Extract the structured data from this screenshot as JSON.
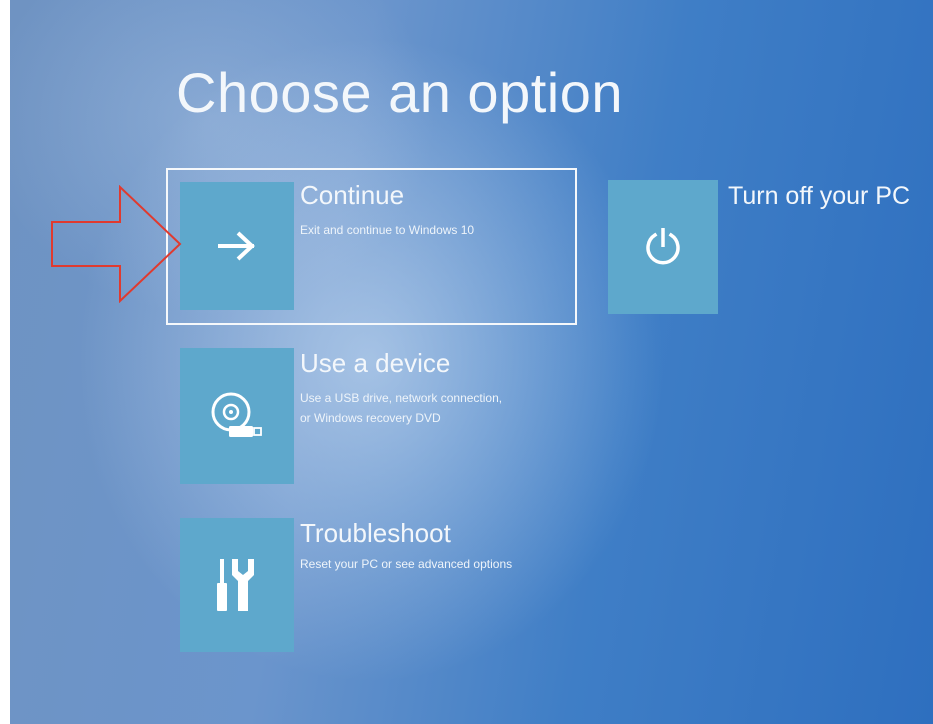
{
  "page": {
    "title": "Choose an option"
  },
  "options": [
    {
      "id": "continue",
      "title": "Continue",
      "description": [
        "Exit and continue to Windows 10"
      ],
      "icon": "arrow-right-icon",
      "selected": true
    },
    {
      "id": "use-device",
      "title": "Use a device",
      "description": [
        "Use a USB drive, network connection,",
        "or Windows recovery DVD"
      ],
      "icon": "disc-usb-icon",
      "selected": false
    },
    {
      "id": "troubleshoot",
      "title": "Troubleshoot",
      "description": [
        "Reset your PC or see advanced options"
      ],
      "icon": "tools-icon",
      "selected": false
    },
    {
      "id": "turn-off",
      "title": "Turn off your PC",
      "description": [],
      "icon": "power-icon",
      "selected": false
    }
  ],
  "annotation": {
    "icon": "red-outline-arrow-icon",
    "color": "#e03a2f"
  },
  "colors": {
    "tile": "#5ea8cc",
    "text": "#f3f7fb"
  }
}
